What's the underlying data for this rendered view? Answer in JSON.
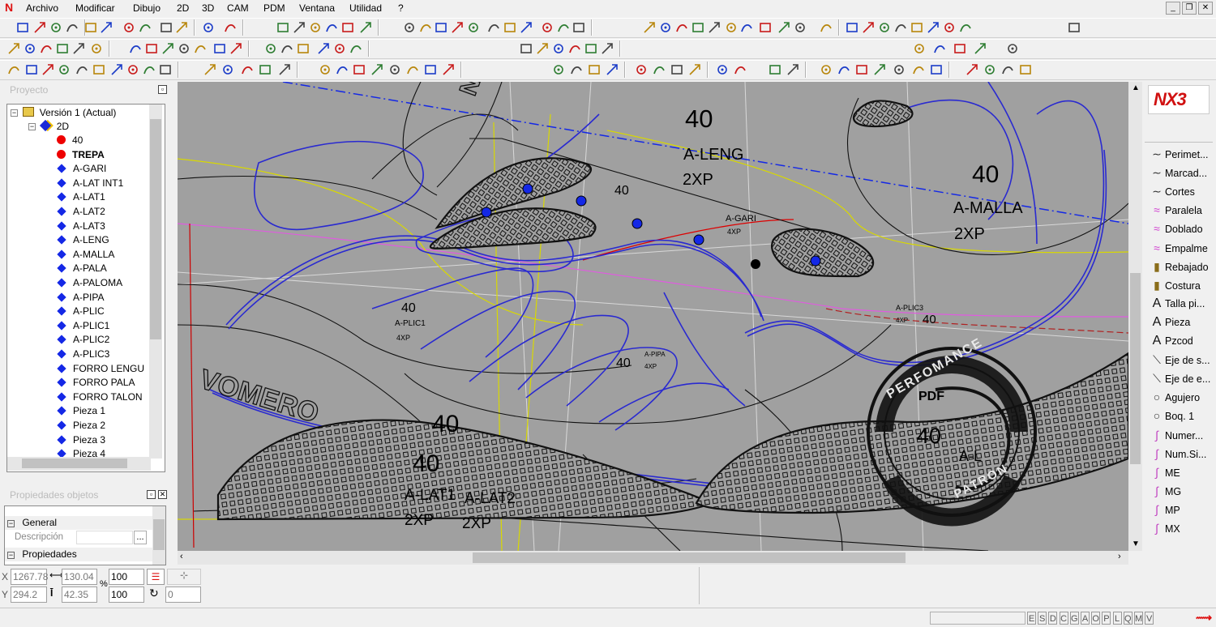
{
  "menu": {
    "items": [
      "Archivo",
      "Modificar",
      "Dibujo",
      "2D",
      "3D",
      "CAM",
      "PDM",
      "Ventana",
      "Utilidad",
      "?"
    ]
  },
  "project_panel": {
    "title": "Proyecto",
    "version": "Versión 1 (Actual)",
    "node_2d": "2D",
    "layers": [
      {
        "label": "40",
        "marker": "red-dot",
        "bold": false
      },
      {
        "label": "TREPA",
        "marker": "red-dot",
        "bold": true
      },
      {
        "label": "A-GARI",
        "marker": "blue-diamond"
      },
      {
        "label": "A-LAT INT1",
        "marker": "blue-diamond"
      },
      {
        "label": "A-LAT1",
        "marker": "blue-diamond"
      },
      {
        "label": "A-LAT2",
        "marker": "blue-diamond"
      },
      {
        "label": "A-LAT3",
        "marker": "blue-diamond"
      },
      {
        "label": "A-LENG",
        "marker": "blue-diamond"
      },
      {
        "label": "A-MALLA",
        "marker": "blue-diamond"
      },
      {
        "label": "A-PALA",
        "marker": "blue-diamond"
      },
      {
        "label": "A-PALOMA",
        "marker": "blue-diamond"
      },
      {
        "label": "A-PIPA",
        "marker": "blue-diamond"
      },
      {
        "label": "A-PLIC",
        "marker": "blue-diamond"
      },
      {
        "label": "A-PLIC1",
        "marker": "blue-diamond"
      },
      {
        "label": "A-PLIC2",
        "marker": "blue-diamond"
      },
      {
        "label": "A-PLIC3",
        "marker": "blue-diamond"
      },
      {
        "label": "FORRO LENGU",
        "marker": "blue-diamond"
      },
      {
        "label": "FORRO PALA",
        "marker": "blue-diamond"
      },
      {
        "label": "FORRO TALON",
        "marker": "blue-diamond"
      },
      {
        "label": "Pieza 1",
        "marker": "blue-diamond"
      },
      {
        "label": "Pieza 2",
        "marker": "blue-diamond"
      },
      {
        "label": "Pieza 3",
        "marker": "blue-diamond"
      },
      {
        "label": "Pieza 4",
        "marker": "blue-diamond"
      }
    ]
  },
  "properties_panel": {
    "title": "Propiedades objetos",
    "group_general": "General",
    "field_descripcion": "Descripción",
    "field_btn": "...",
    "group_propiedades": "Propiedades"
  },
  "canvas": {
    "labels": {
      "top_size": "40",
      "a_leng": "A-LENG",
      "a_leng_qty": "2XP",
      "mid_size": "40",
      "a_gari": "A-GARI",
      "a_gari_qty": "4XP",
      "right_size": "40",
      "a_malla": "A-MALLA",
      "a_malla_qty": "2XP",
      "small_40_a": "40",
      "a_plic1": "A-PLIC1",
      "a_plic1_qty": "4XP",
      "small_40_b": "40",
      "a_pipa": "A-PIPA",
      "a_pipa_qty": "4XP",
      "a_plic3": "A-PLIC3",
      "a_plic3_qty": "4XP",
      "small_40_c": "40",
      "vomero": "VOMERO",
      "nike": "NIKE",
      "bottom_size": "40",
      "bottom_size2": "40",
      "a_lat1": "A-LAT1",
      "a_lat2": "A-LAT2",
      "lat1_qty": "2XP",
      "lat2_qty": "2XP",
      "watermark_top": "PERFOMANCE",
      "watermark_bottom": "PATRON",
      "watermark_pdf": "PDF",
      "watermark_size": "40",
      "watermark_piece": "A-L"
    }
  },
  "right_tools": {
    "logo": "NX3",
    "items": [
      {
        "label": "Perimet...",
        "icon": "curve-icon"
      },
      {
        "label": "Marcad...",
        "icon": "curve-icon"
      },
      {
        "label": "Cortes",
        "icon": "curve-icon"
      },
      {
        "label": "Paralela",
        "icon": "parallel-icon"
      },
      {
        "label": "Doblado",
        "icon": "fold-icon"
      },
      {
        "label": "Empalme",
        "icon": "join-icon"
      },
      {
        "label": "Rebajado",
        "icon": "skive-icon"
      },
      {
        "label": "Costura",
        "icon": "seam-icon"
      },
      {
        "label": "Talla pi...",
        "icon": "text-a-icon"
      },
      {
        "label": "Pieza",
        "icon": "text-a-icon"
      },
      {
        "label": "Pzcod",
        "icon": "text-a-icon"
      },
      {
        "label": "Eje de s...",
        "icon": "axis-icon"
      },
      {
        "label": "Eje de e...",
        "icon": "axis-icon"
      },
      {
        "label": "Agujero",
        "icon": "circle-icon"
      },
      {
        "label": "Boq. 1",
        "icon": "circle-icon"
      },
      {
        "label": "Numer...",
        "icon": "number-icon"
      },
      {
        "label": "Num.Si...",
        "icon": "number-icon"
      },
      {
        "label": "ME",
        "icon": "mark-icon"
      },
      {
        "label": "MG",
        "icon": "mark-icon"
      },
      {
        "label": "MP",
        "icon": "mark-icon"
      },
      {
        "label": "MX",
        "icon": "mark-icon"
      }
    ]
  },
  "coords": {
    "x_label": "X",
    "y_label": "Y",
    "x": "1267.78",
    "y": "294.2",
    "dx": "130.04",
    "dy": "42.35",
    "pct_label": "%",
    "scale1": "100",
    "scale2": "100",
    "angle": "0"
  },
  "status_flags": [
    "E",
    "S",
    "D",
    "C",
    "G",
    "A",
    "O",
    "P",
    "L",
    "Q",
    "M",
    "V"
  ]
}
